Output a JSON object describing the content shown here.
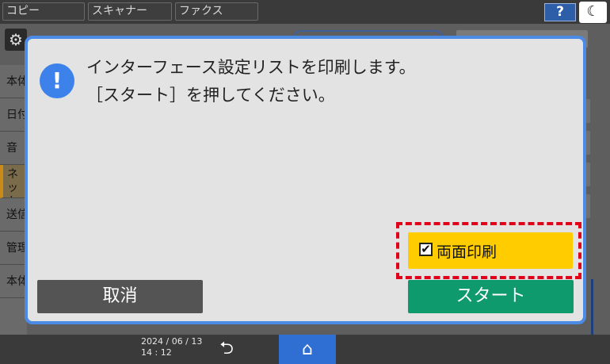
{
  "top_tabs": [
    {
      "label": "コピー"
    },
    {
      "label": "スキャナー"
    },
    {
      "label": "ファクス"
    }
  ],
  "top_icons": {
    "help": "?",
    "moon": "☾",
    "gear": "⚙"
  },
  "side_menu": [
    {
      "label": "本体"
    },
    {
      "label": "日付"
    },
    {
      "label": "音"
    },
    {
      "label": "ネットワーク"
    },
    {
      "label": "送信"
    },
    {
      "label": "管理"
    },
    {
      "label": "本体"
    }
  ],
  "dialog": {
    "icon": "!",
    "message_line1": "インターフェース設定リストを印刷します。",
    "message_line2": "［スタート］を押してください。",
    "duplex_label": "両面印刷",
    "duplex_checked": true,
    "check_mark": "✔",
    "cancel_label": "取消",
    "start_label": "スタート"
  },
  "status": {
    "date": "2024 / 06 / 13",
    "time": "14 : 12",
    "back_icon": "⮌",
    "home_icon": "⌂"
  },
  "colors": {
    "dialog_border": "#4b8be6",
    "duplex_button": "#ffcc00",
    "highlight_outline": "#e0001a",
    "start_button": "#0f9a6e",
    "home_button": "#2f6fd4"
  }
}
